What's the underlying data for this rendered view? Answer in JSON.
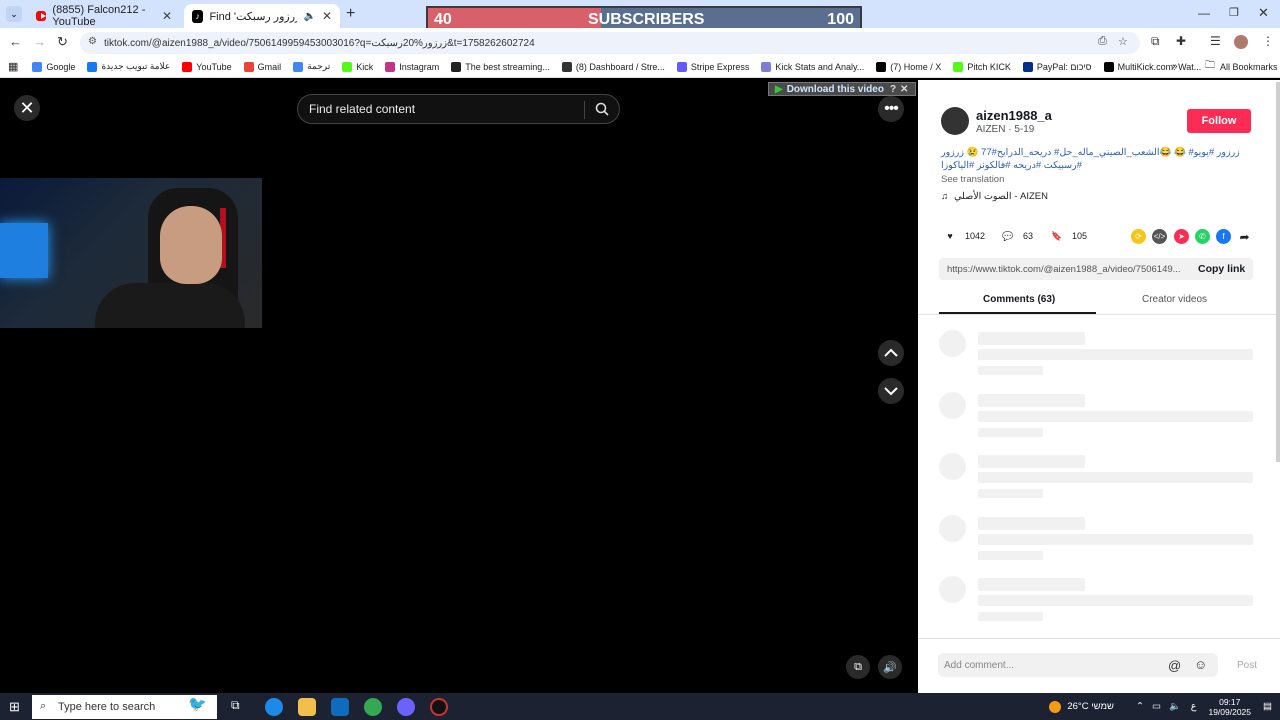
{
  "browser": {
    "tabs": [
      {
        "label": "(8855) Falcon212 - YouTube",
        "active": false
      },
      {
        "label": "Find 'زرزور رسبكت' on TikTo",
        "active": true
      }
    ],
    "url": "tiktok.com/@aizen1988_a/video/7506149959453003016?q=زرزور%20رسبكت&t=1758262602724",
    "bookmarks": [
      {
        "label": "Google",
        "color": "#4285f4"
      },
      {
        "label": "علامة تبويب جديدة",
        "color": "#1877f2"
      },
      {
        "label": "YouTube",
        "color": "#ff0000"
      },
      {
        "label": "Gmail",
        "color": "#ea4335"
      },
      {
        "label": "ترجمة",
        "color": "#4285f4"
      },
      {
        "label": "Kick",
        "color": "#53fc18"
      },
      {
        "label": "Instagram",
        "color": "#c13584"
      },
      {
        "label": "The best streaming...",
        "color": "#222222"
      },
      {
        "label": "(8) Dashboard / Stre...",
        "color": "#333333"
      },
      {
        "label": "Stripe Express",
        "color": "#635bff"
      },
      {
        "label": "Kick Stats and Analy...",
        "color": "#7d7dd8"
      },
      {
        "label": "(7) Home / X",
        "color": "#000000"
      },
      {
        "label": "Pitch KICK",
        "color": "#53fc18"
      },
      {
        "label": "PayPal: סיכום",
        "color": "#003087"
      },
      {
        "label": "MultiKick.com: Wat...",
        "color": "#000000"
      }
    ],
    "all_bookmarks": "All Bookmarks"
  },
  "subscribers_banner": {
    "current": "40",
    "label": "SUBSCRIBERS",
    "goal": "100",
    "progress": 0.4
  },
  "video": {
    "search_placeholder": "Find related content",
    "download_label": "Download this video"
  },
  "panel": {
    "username": "aizen1988_a",
    "subline": "AIZEN · 5-19",
    "follow_label": "Follow",
    "caption": "زرزور #يويو# 😂 😂الشعب_الصيني_ماله_حل# دريحه_الدرايح#77 😢 زرزور #رسبيكت #دريحه #فالكونز #الياكوزا",
    "see_translation": "See translation",
    "sound": "الصوت الأصلي - AIZEN",
    "likes": "1042",
    "comments": "63",
    "saves": "105",
    "link": "https://www.tiktok.com/@aizen1988_a/video/7506149...",
    "copy_link": "Copy link",
    "tab_comments": "Comments (63)",
    "tab_creator": "Creator videos",
    "add_comment_placeholder": "Add comment...",
    "post_label": "Post"
  },
  "taskbar": {
    "search_placeholder": "Type here to search",
    "weather": "26°C  שמשי",
    "lang": "ع",
    "time": "09:17",
    "date": "19/09/2025"
  }
}
